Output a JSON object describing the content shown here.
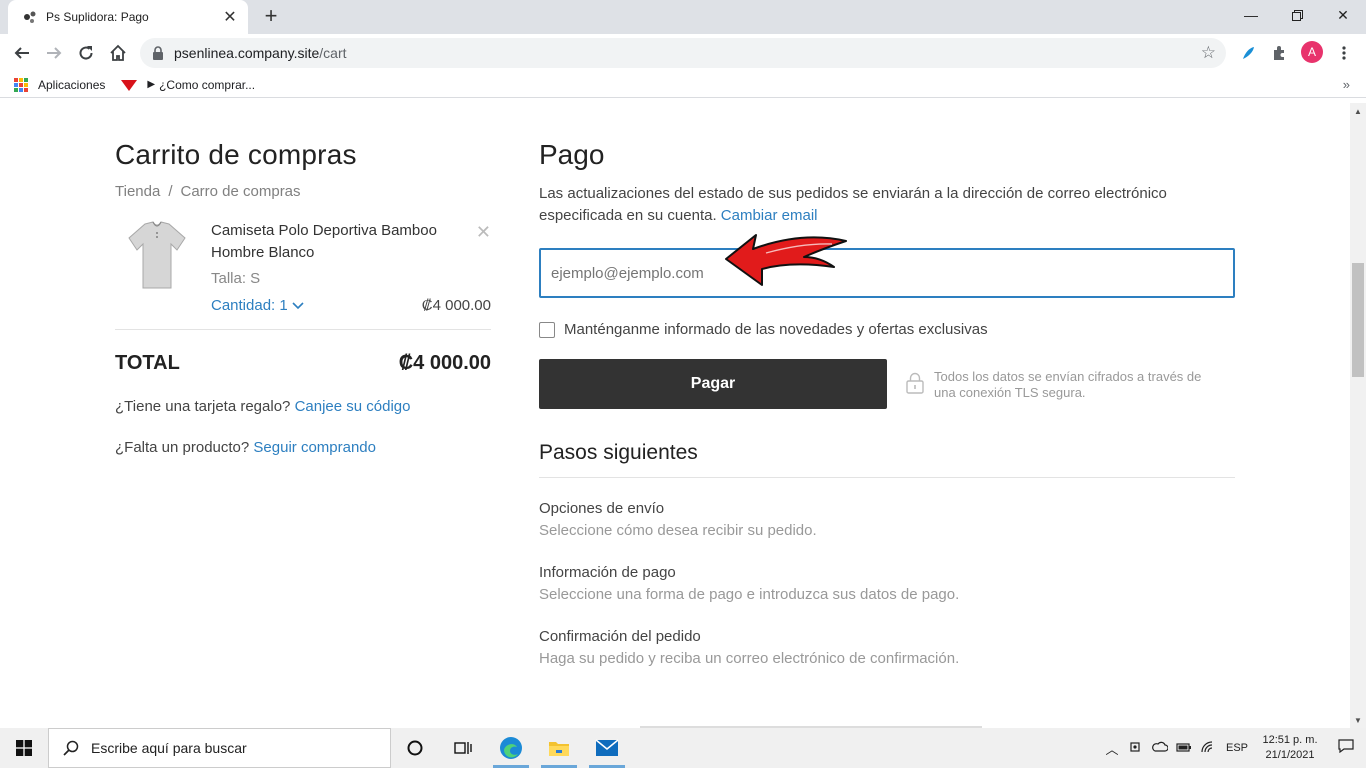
{
  "browser": {
    "tab_title": "Ps Suplidora: Pago",
    "url_host": "psenlinea.company.site",
    "url_path": "/cart",
    "avatar_letter": "A",
    "bookmarks": [
      "Aplicaciones",
      "¿Como comprar..."
    ]
  },
  "cart": {
    "title": "Carrito de compras",
    "breadcrumb": [
      "Tienda",
      "Carro de compras"
    ],
    "item": {
      "name": "Camiseta Polo Deportiva Bamboo Hombre Blanco",
      "size": "Talla: S",
      "quantity": "Cantidad: 1",
      "price": "₡4 000.00"
    },
    "total_label": "TOTAL",
    "total_amount": "₡4 000.00",
    "gift_text": "¿Tiene una tarjeta regalo?",
    "gift_link": "Canjee su código",
    "missing_text": "¿Falta un producto?",
    "missing_link": "Seguir comprando"
  },
  "payment": {
    "title": "Pago",
    "note": "Las actualizaciones del estado de sus pedidos se enviarán a la dirección de correo electrónico especificada en su cuenta.",
    "change_email": "Cambiar email",
    "email_placeholder": "ejemplo@ejemplo.com",
    "newsletter_label": "Manténganme informado de las novedades y ofertas exclusivas",
    "pay_button": "Pagar",
    "secure_note": "Todos los datos se envían cifrados a través de una conexión TLS segura.",
    "next_steps_title": "Pasos siguientes",
    "steps": [
      {
        "title": "Opciones de envío",
        "desc": "Seleccione cómo desea recibir su pedido."
      },
      {
        "title": "Información de pago",
        "desc": "Seleccione una forma de pago e introduzca sus datos de pago."
      },
      {
        "title": "Confirmación del pedido",
        "desc": "Haga su pedido y reciba un correo electrónico de confirmación."
      }
    ]
  },
  "taskbar": {
    "search_placeholder": "Escribe aquí para buscar",
    "lang": "ESP",
    "time": "12:51 p. m.",
    "date": "21/1/2021"
  },
  "colors": {
    "link": "#2d7fc0",
    "pay_button": "#333333",
    "annotation_arrow": "#e11b1b"
  }
}
